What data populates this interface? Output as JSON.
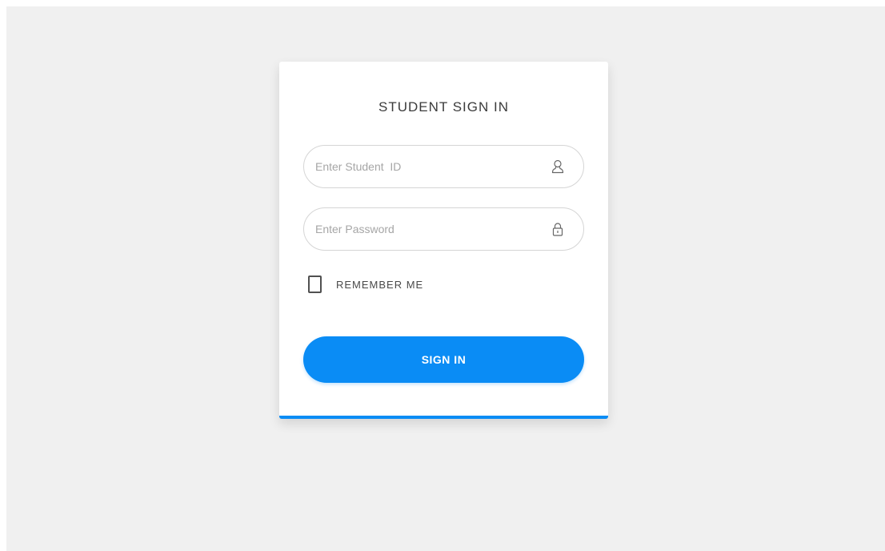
{
  "form": {
    "title": "STUDENT SIGN IN",
    "student_id": {
      "placeholder": "Enter Student  ID",
      "value": "",
      "icon": "user-icon"
    },
    "password": {
      "placeholder": "Enter Password",
      "value": "",
      "icon": "lock-icon"
    },
    "remember_me": {
      "label": "REMEMBER ME",
      "checked": false
    },
    "submit_label": "SIGN IN"
  },
  "colors": {
    "accent": "#0a8cf5",
    "page_background": "#f0f0f0",
    "card_background": "#ffffff"
  }
}
